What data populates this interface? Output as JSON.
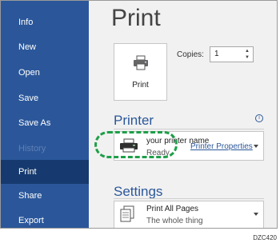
{
  "sidebar": {
    "items": [
      {
        "label": "Info"
      },
      {
        "label": "New"
      },
      {
        "label": "Open"
      },
      {
        "label": "Save"
      },
      {
        "label": "Save As"
      },
      {
        "label": "History"
      },
      {
        "label": "Print"
      },
      {
        "label": "Share"
      },
      {
        "label": "Export"
      }
    ]
  },
  "main": {
    "title": "Print",
    "print_button_label": "Print",
    "copies_label": "Copies:",
    "copies_value": "1",
    "printer_header": "Printer",
    "printer_name": "your printer name",
    "printer_status": "Ready",
    "printer_properties_link": "Printer Properties",
    "settings_header": "Settings",
    "setting_title": "Print All Pages",
    "setting_subtitle": "The whole thing",
    "info_icon": "i"
  },
  "figure_code": "DZC420",
  "colors": {
    "sidebar": "#2b579a",
    "sidebar_selected": "#163a6f",
    "accent": "#2b579a",
    "highlight": "#1e9f49"
  }
}
